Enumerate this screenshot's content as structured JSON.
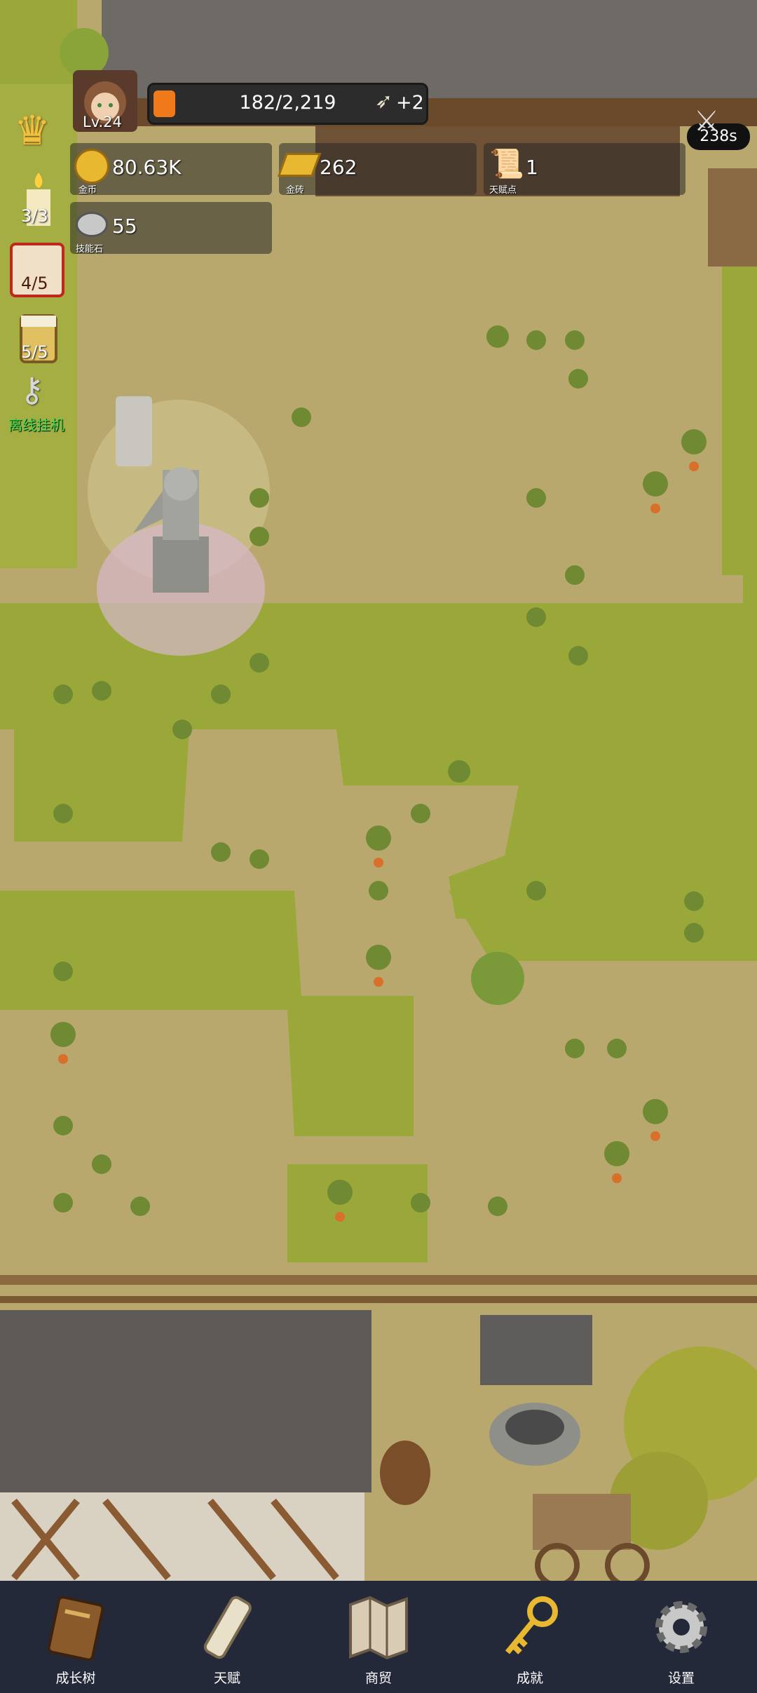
{
  "player": {
    "level": "Lv.24"
  },
  "xp_bar": {
    "text": "182/2,219",
    "bonus": "+2",
    "fill_fraction": 0.082
  },
  "timer": {
    "text": "238s"
  },
  "resources": [
    {
      "value": "80.63K",
      "caption": "金币",
      "icon": "gold-coin-icon"
    },
    {
      "value": "262",
      "caption": "金砖",
      "icon": "gold-brick-icon"
    },
    {
      "value": "1",
      "caption": "天赋点",
      "icon": "talent-scroll-icon"
    },
    {
      "value": "55",
      "caption": "技能石",
      "icon": "skill-stone-icon"
    }
  ],
  "side_menu": {
    "candle": "3/3",
    "dice": "4/5",
    "beer": "5/5",
    "idle_label": "离线挂机"
  },
  "bottom_nav": [
    {
      "label": "成长树",
      "icon": "book-icon"
    },
    {
      "label": "天赋",
      "icon": "scroll-icon"
    },
    {
      "label": "商贸",
      "icon": "map-icon"
    },
    {
      "label": "成就",
      "icon": "key-icon"
    },
    {
      "label": "设置",
      "icon": "gear-icon"
    }
  ],
  "colors": {
    "dirt": "#b9a86e",
    "grass": "#9aa83a",
    "nav_bg": "#232938",
    "idle_green": "#3fe04a",
    "xp_orange": "#f07a1a"
  }
}
